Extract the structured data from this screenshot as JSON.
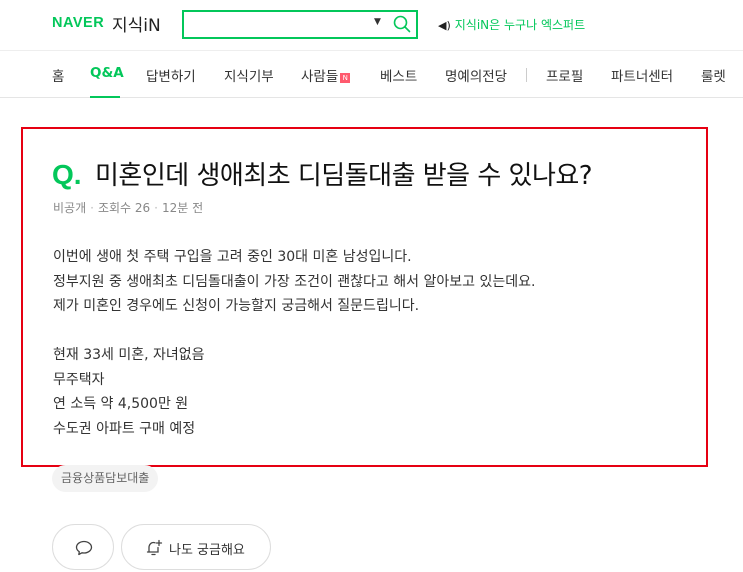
{
  "header": {
    "logo": "NAVER",
    "service_name": "지식iN",
    "search_placeholder": "",
    "promo_text": "지식iN은 누구나 엑스퍼트"
  },
  "nav": {
    "items": [
      "홈",
      "Q&A",
      "답변하기",
      "지식기부",
      "사람들",
      "베스트",
      "명예의전당",
      "프로필",
      "파트너센터",
      "룰렛"
    ],
    "active": "Q&A",
    "new_badge": "N"
  },
  "question": {
    "mark": "Q.",
    "title": "미혼인데 생애최초 디딤돌대출 받을 수 있나요?",
    "meta": {
      "visibility": "비공개",
      "views": "조회수 26",
      "time": "12분 전"
    },
    "body": {
      "paragraph1": [
        "이번에 생애 첫 주택 구입을 고려 중인 30대 미혼 남성입니다.",
        "정부지원 중 생애최초 디딤돌대출이 가장 조건이 괜찮다고 해서 알아보고 있는데요.",
        "제가 미혼인 경우에도 신청이 가능할지 궁금해서 질문드립니다."
      ],
      "paragraph2": [
        "현재 33세 미혼, 자녀없음",
        "무주택자",
        "연 소득 약 4,500만 원",
        "수도권 아파트 구매 예정"
      ]
    },
    "tag": "금융상품담보대출"
  },
  "actions": {
    "curious_label": "나도 궁금해요"
  },
  "colors": {
    "brand_green": "#03c75a",
    "highlight_border": "#e60012"
  }
}
